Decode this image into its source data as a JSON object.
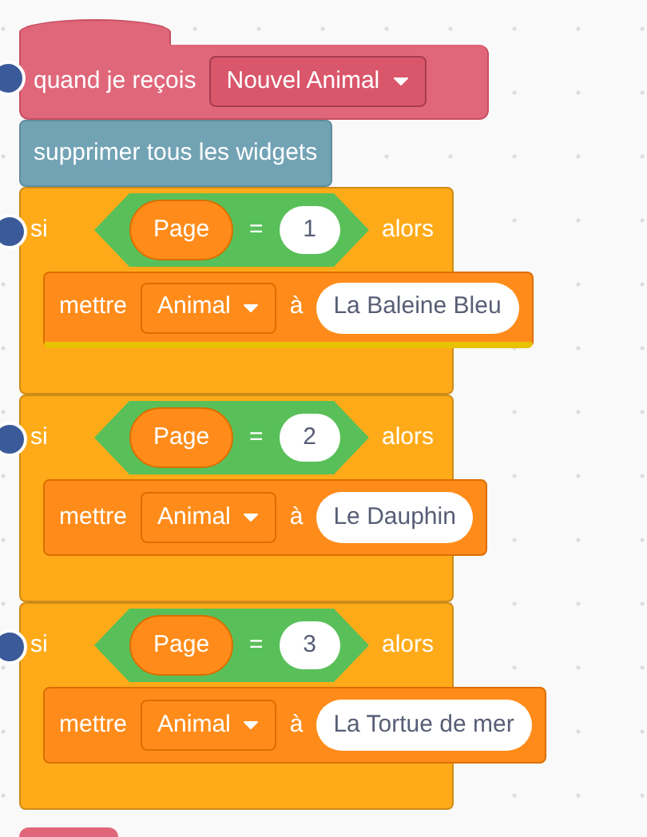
{
  "hat_block": {
    "label": "quand je reçois",
    "message": "Nouvel Animal"
  },
  "blocks": [
    {
      "kind": "command",
      "label": "supprimer tous les widgets"
    },
    {
      "kind": "if",
      "keyword": "si",
      "condition": {
        "variable": "Page",
        "operator": "=",
        "value": "1"
      },
      "then_label": "alors",
      "body": [
        {
          "kind": "set",
          "label": "mettre",
          "variable": "Animal",
          "to_label": "à",
          "value": "La Baleine Bleu",
          "highlighted": true
        }
      ]
    },
    {
      "kind": "if",
      "keyword": "si",
      "condition": {
        "variable": "Page",
        "operator": "=",
        "value": "2"
      },
      "then_label": "alors",
      "body": [
        {
          "kind": "set",
          "label": "mettre",
          "variable": "Animal",
          "to_label": "à",
          "value": "Le Dauphin",
          "highlighted": false
        }
      ]
    },
    {
      "kind": "if",
      "keyword": "si",
      "condition": {
        "variable": "Page",
        "operator": "=",
        "value": "3"
      },
      "then_label": "alors",
      "body": [
        {
          "kind": "set",
          "label": "mettre",
          "variable": "Animal",
          "to_label": "à",
          "value": "La Tortue de mer",
          "highlighted": false
        }
      ]
    }
  ]
}
